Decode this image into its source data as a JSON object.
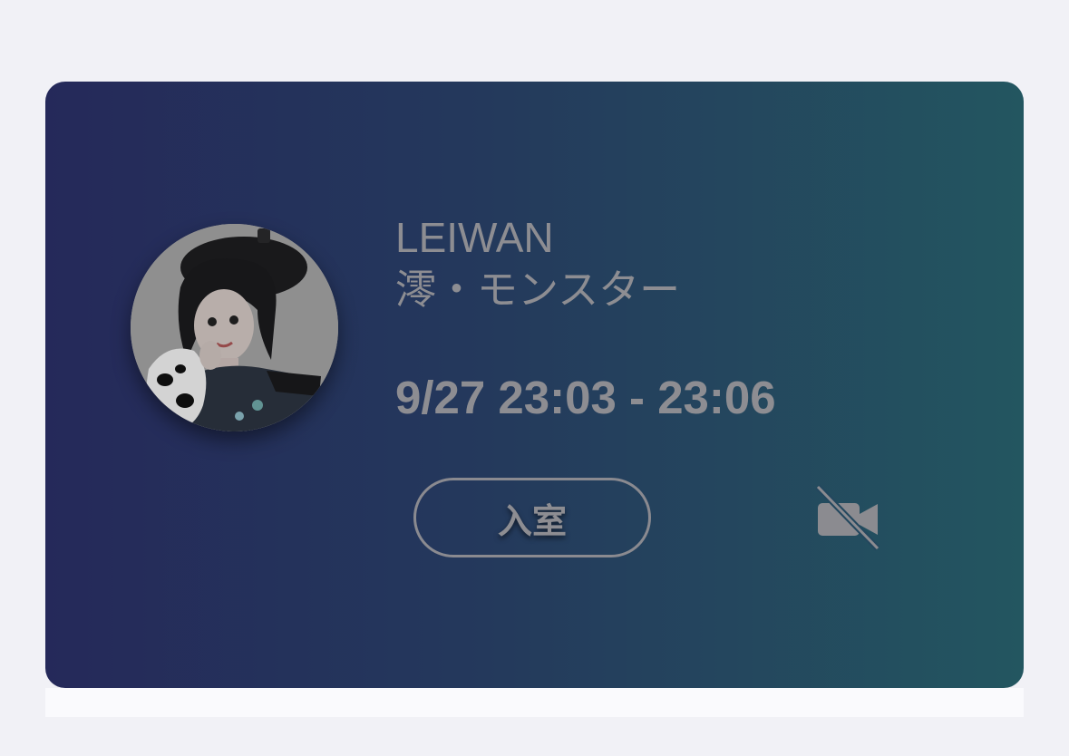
{
  "card": {
    "performer_name": "LEIWAN",
    "group_name": "澪・モンスター",
    "time_range": "9/27 23:03 - 23:06",
    "enter_button_label": "入室",
    "icons": {
      "camera": "video-camera-off-icon",
      "avatar": "performer-avatar"
    },
    "colors": {
      "gradient_start": "#25295a",
      "gradient_end": "#235660",
      "text": "#8d8d92",
      "page_background": "#f1f1f6"
    }
  }
}
